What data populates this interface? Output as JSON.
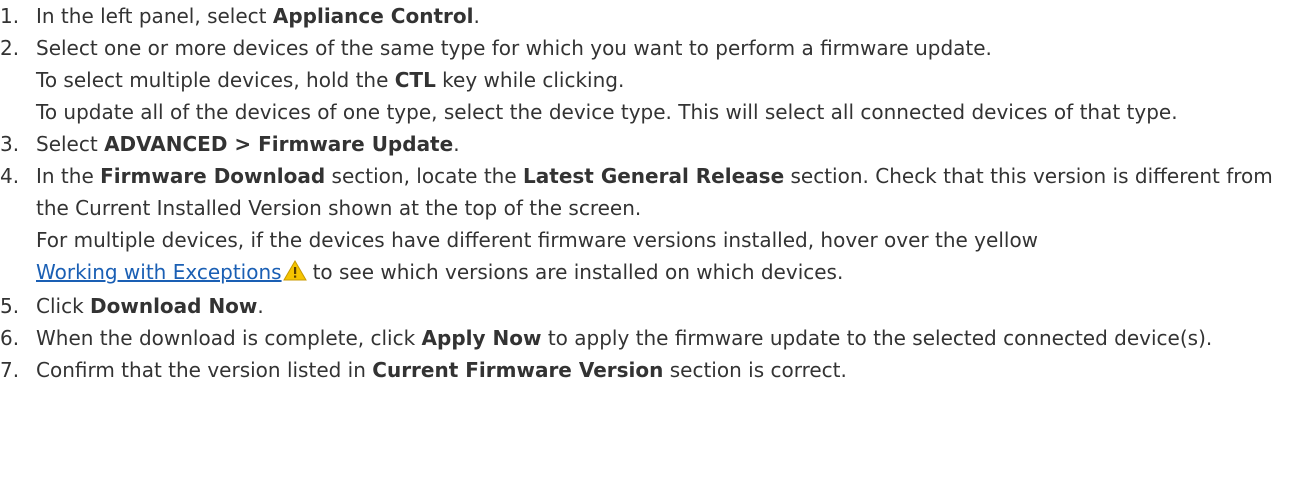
{
  "steps": [
    {
      "num": "1.",
      "parts": [
        "In the left panel, select ",
        "Appliance Control",
        "."
      ]
    },
    {
      "num": "2.",
      "lines": [
        "Select one or more devices of the same type for which you want to perform a firmware update.",
        [
          "To select multiple devices, hold the ",
          "CTL",
          " key while clicking."
        ],
        "To update all of the devices of one type, select the device type. This will select all connected devices of that type."
      ]
    },
    {
      "num": "3.",
      "parts": [
        "Select ",
        "ADVANCED > Firmware Update",
        "."
      ]
    },
    {
      "num": "4.",
      "para1": [
        "In the ",
        "Firmware Download",
        " section, locate the ",
        "Latest General Release",
        " section. Check that this version is different from the Current Installed Version shown at the top of the screen."
      ],
      "para2": "For multiple devices, if the devices have different firmware versions installed, hover over the yellow",
      "link": "Working with Exceptions",
      "after_link": "to see which versions are installed on which devices.",
      "icon": "warning-icon",
      "icon_color": "#f5c400"
    },
    {
      "num": "5.",
      "parts": [
        "Click ",
        "Download Now",
        "."
      ]
    },
    {
      "num": "6.",
      "parts": [
        "When the download is complete, click ",
        "Apply Now",
        " to apply the firmware update to the selected connected device(s)."
      ]
    },
    {
      "num": "7.",
      "parts": [
        "Confirm that the version listed in ",
        "Current Firmware Version",
        " section is correct."
      ]
    }
  ]
}
